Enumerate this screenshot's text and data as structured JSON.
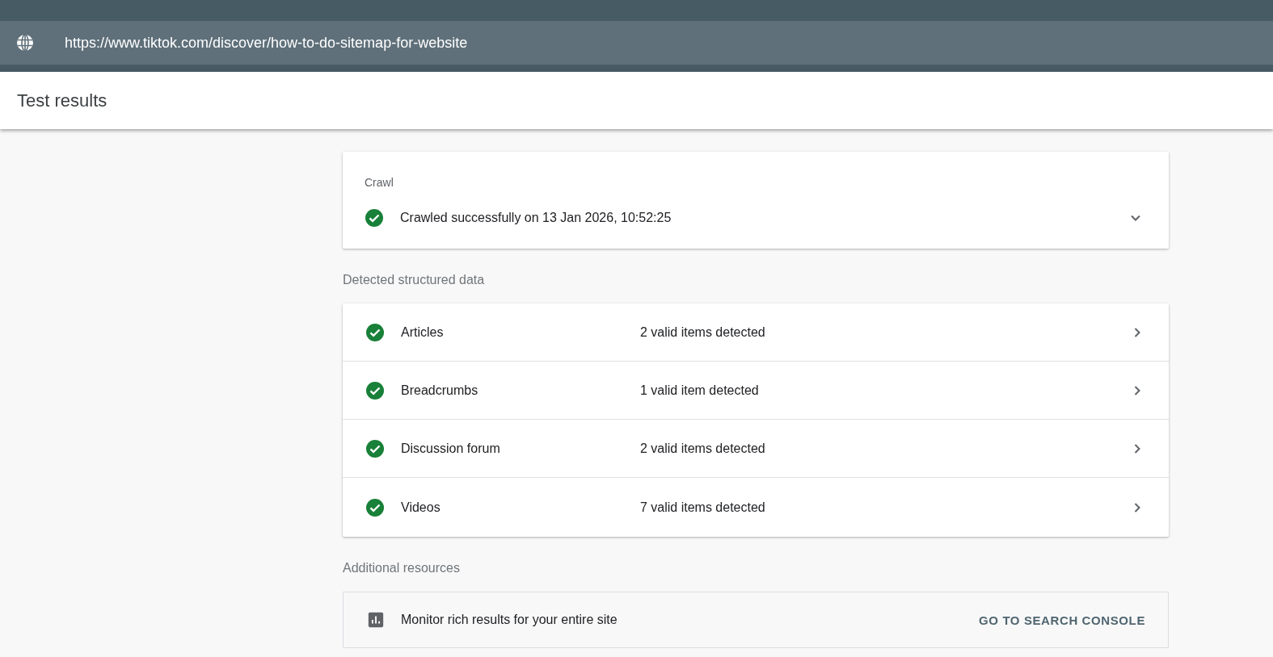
{
  "url_bar": {
    "url": "https://www.tiktok.com/discover/how-to-do-sitemap-for-website"
  },
  "header": {
    "title": "Test results"
  },
  "crawl": {
    "label": "Crawl",
    "status": "Crawled successfully on 13 Jan 2026, 10:52:25",
    "valid": true,
    "expanded": false
  },
  "structured_data": {
    "heading": "Detected structured data",
    "items": [
      {
        "name": "Articles",
        "summary": "2 valid items detected",
        "valid": true
      },
      {
        "name": "Breadcrumbs",
        "summary": "1 valid item detected",
        "valid": true
      },
      {
        "name": "Discussion forum",
        "summary": "2 valid items detected",
        "valid": true
      },
      {
        "name": "Videos",
        "summary": "7 valid items detected",
        "valid": true
      }
    ]
  },
  "resources": {
    "heading": "Additional resources",
    "items": [
      {
        "text": "Monitor rich results for your entire site",
        "action": "GO TO SEARCH CONSOLE"
      }
    ]
  }
}
